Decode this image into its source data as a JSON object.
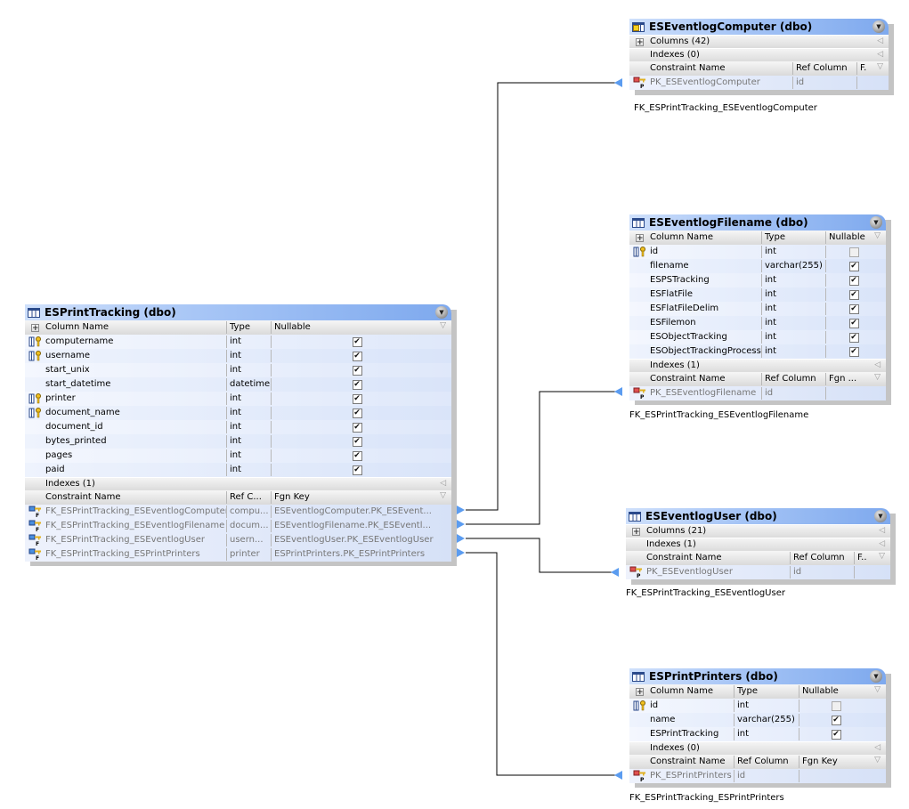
{
  "main_table": {
    "title": "ESPrintTracking (dbo)",
    "column_headers": {
      "name": "Column Name",
      "type": "Type",
      "nullable": "Nullable"
    },
    "columns": [
      {
        "name": "computername",
        "type": "int",
        "nullable": true,
        "fk": true
      },
      {
        "name": "username",
        "type": "int",
        "nullable": true,
        "fk": true
      },
      {
        "name": "start_unix",
        "type": "int",
        "nullable": true,
        "fk": false
      },
      {
        "name": "start_datetime",
        "type": "datetime",
        "nullable": true,
        "fk": false
      },
      {
        "name": "printer",
        "type": "int",
        "nullable": true,
        "fk": true
      },
      {
        "name": "document_name",
        "type": "int",
        "nullable": true,
        "fk": true
      },
      {
        "name": "document_id",
        "type": "int",
        "nullable": true,
        "fk": false
      },
      {
        "name": "bytes_printed",
        "type": "int",
        "nullable": true,
        "fk": false
      },
      {
        "name": "pages",
        "type": "int",
        "nullable": true,
        "fk": false
      },
      {
        "name": "paid",
        "type": "int",
        "nullable": true,
        "fk": false
      }
    ],
    "indexes_label": "Indexes (1)",
    "constraint_headers": {
      "name": "Constraint Name",
      "ref": "Ref C...",
      "fgn": "Fgn Key"
    },
    "constraints": [
      {
        "name": "FK_ESPrintTracking_ESEventlogComputer",
        "ref": "compu...",
        "fgn": "ESEventlogComputer.PK_ESEvent..."
      },
      {
        "name": "FK_ESPrintTracking_ESEventlogFilename",
        "ref": "docum...",
        "fgn": "ESEventlogFilename.PK_ESEventl..."
      },
      {
        "name": "FK_ESPrintTracking_ESEventlogUser",
        "ref": "usern...",
        "fgn": "ESEventlogUser.PK_ESEventlogUser"
      },
      {
        "name": "FK_ESPrintTracking_ESPrintPrinters",
        "ref": "printer",
        "fgn": "ESPrintPrinters.PK_ESPrintPrinters"
      }
    ]
  },
  "computer_table": {
    "title": "ESEventlogComputer (dbo)",
    "columns_label": "Columns (42)",
    "indexes_label": "Indexes (0)",
    "constraint_headers": {
      "name": "Constraint Name",
      "ref": "Ref Column",
      "fgn": "F."
    },
    "constraint": {
      "name": "PK_ESEventlogComputer",
      "ref": "id",
      "fgn": ""
    },
    "relation_label": "FK_ESPrintTracking_ESEventlogComputer"
  },
  "filename_table": {
    "title": "ESEventlogFilename (dbo)",
    "column_headers": {
      "name": "Column Name",
      "type": "Type",
      "nullable": "Nullable"
    },
    "columns": [
      {
        "name": "id",
        "type": "int",
        "nullable": false,
        "pk": true
      },
      {
        "name": "filename",
        "type": "varchar(255)",
        "nullable": true,
        "pk": false
      },
      {
        "name": "ESPSTracking",
        "type": "int",
        "nullable": true,
        "pk": false
      },
      {
        "name": "ESFlatFile",
        "type": "int",
        "nullable": true,
        "pk": false
      },
      {
        "name": "ESFlatFileDelim",
        "type": "int",
        "nullable": true,
        "pk": false
      },
      {
        "name": "ESFilemon",
        "type": "int",
        "nullable": true,
        "pk": false
      },
      {
        "name": "ESObjectTracking",
        "type": "int",
        "nullable": true,
        "pk": false
      },
      {
        "name": "ESObjectTrackingProcess",
        "type": "int",
        "nullable": true,
        "pk": false
      }
    ],
    "indexes_label": "Indexes (1)",
    "constraint_headers": {
      "name": "Constraint Name",
      "ref": "Ref Column",
      "fgn": "Fgn ..."
    },
    "constraint": {
      "name": "PK_ESEventlogFilename",
      "ref": "id",
      "fgn": ""
    },
    "relation_label": "FK_ESPrintTracking_ESEventlogFilename"
  },
  "user_table": {
    "title": "ESEventlogUser (dbo)",
    "columns_label": "Columns (21)",
    "indexes_label": "Indexes (1)",
    "constraint_headers": {
      "name": "Constraint Name",
      "ref": "Ref Column",
      "fgn": "F.."
    },
    "constraint": {
      "name": "PK_ESEventlogUser",
      "ref": "id",
      "fgn": ""
    },
    "relation_label": "FK_ESPrintTracking_ESEventlogUser"
  },
  "printers_table": {
    "title": "ESPrintPrinters (dbo)",
    "column_headers": {
      "name": "Column Name",
      "type": "Type",
      "nullable": "Nullable"
    },
    "columns": [
      {
        "name": "id",
        "type": "int",
        "nullable": false,
        "pk": true
      },
      {
        "name": "name",
        "type": "varchar(255)",
        "nullable": true,
        "pk": false
      },
      {
        "name": "ESPrintTracking",
        "type": "int",
        "nullable": true,
        "pk": false
      }
    ],
    "indexes_label": "Indexes (0)",
    "constraint_headers": {
      "name": "Constraint Name",
      "ref": "Ref Column",
      "fgn": "Fgn Key"
    },
    "constraint": {
      "name": "PK_ESPrintPrinters",
      "ref": "id",
      "fgn": ""
    },
    "relation_label": "FK_ESPrintTracking_ESPrintPrinters"
  },
  "colors": {
    "header_gradient_start": "#cfe0fb",
    "header_gradient_end": "#7ea9ee",
    "row_bg": "#e4ebfb",
    "connector": "#000000",
    "arrow": "#5b9cf0",
    "shadow": "#c4c4c4"
  }
}
